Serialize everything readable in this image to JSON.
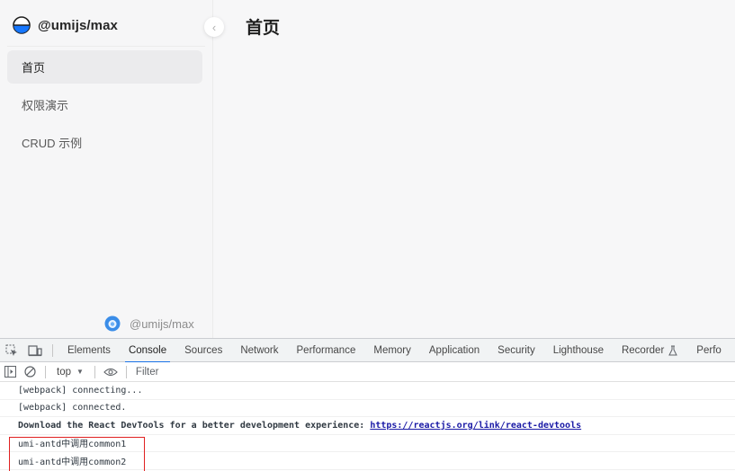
{
  "app": {
    "brand": "@umijs/max",
    "collapse_glyph": "‹",
    "page_title": "首页",
    "menu": [
      {
        "label": "首页",
        "active": true
      },
      {
        "label": "权限演示",
        "active": false
      },
      {
        "label": "CRUD 示例",
        "active": false
      }
    ],
    "footer_brand": "@umijs/max"
  },
  "devtools": {
    "icons": {
      "inspect": "inspect-element-icon",
      "device": "device-toolbar-icon"
    },
    "tabs": [
      "Elements",
      "Console",
      "Sources",
      "Network",
      "Performance",
      "Memory",
      "Application",
      "Security",
      "Lighthouse",
      "Recorder",
      "Perfo"
    ],
    "active_tab": "Console",
    "recorder_icon": "flask-icon",
    "toolbar": {
      "context": "top",
      "filter_placeholder": "Filter"
    },
    "console_lines": [
      {
        "text": "[webpack] connecting..."
      },
      {
        "text": "[webpack] connected."
      },
      {
        "text": "Download the React DevTools for a better development experience:",
        "link": "https://reactjs.org/link/react-devtools"
      },
      {
        "text": "umi-antd中调用common1"
      },
      {
        "text": "umi-antd中调用common2"
      }
    ]
  },
  "colors": {
    "accent": "#1a73e8",
    "highlight": "#e02020",
    "link": "#1a1aa6"
  }
}
